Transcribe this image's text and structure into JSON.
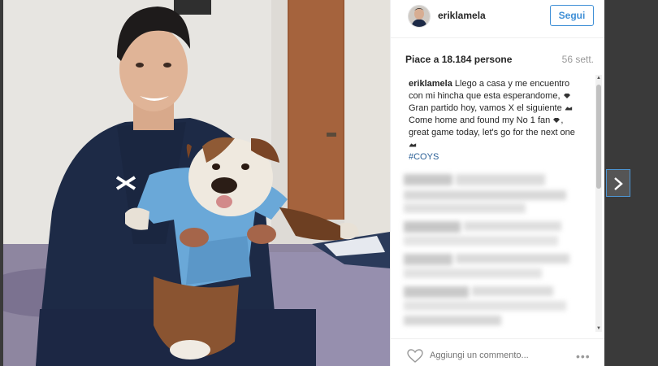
{
  "post": {
    "username": "eriklamela",
    "follow_label": "Segui",
    "likes": "Piace a 18.184 persone",
    "time_ago": "56 sett.",
    "caption": {
      "user": "eriklamela",
      "text_es_1": "Llego a casa y me encuentro con mi hincha que esta esperandome,",
      "text_es_2": "Gran partido hoy, vamos X el siguiente",
      "text_en_1": "Come home and found my No 1 fan",
      "text_en_2": ", great game today, let's go for the next one",
      "hashtag": "#COYS"
    },
    "comment_placeholder": "Aggiungi un commento...",
    "more_label": "•••"
  },
  "colors": {
    "follow_blue": "#3f8fd6",
    "hashtag_blue": "#2a5f96",
    "background": "#3a3a3a"
  },
  "icons": {
    "heart": "heart-icon",
    "next": "chevron-right-icon",
    "more": "more-options-icon"
  }
}
